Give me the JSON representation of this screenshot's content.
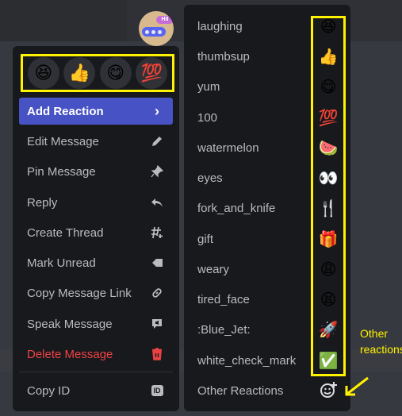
{
  "colors": {
    "accent": "#4752c4",
    "danger": "#ed4245",
    "highlight": "#fff200",
    "menu_bg": "#18191c"
  },
  "avatar": {
    "badge": "HII"
  },
  "quick_reactions": [
    {
      "icon": "laughing",
      "glyph": "😆"
    },
    {
      "icon": "thumbsup",
      "glyph": "👍"
    },
    {
      "icon": "yum",
      "glyph": "😋"
    },
    {
      "icon": "100",
      "glyph": "💯"
    }
  ],
  "menu": {
    "add_reaction": "Add Reaction",
    "add_reaction_chevron": "›",
    "edit": "Edit Message",
    "pin": "Pin Message",
    "reply": "Reply",
    "create_thread": "Create Thread",
    "mark_unread": "Mark Unread",
    "copy_link": "Copy Message Link",
    "speak": "Speak Message",
    "delete": "Delete Message",
    "copy_id": "Copy ID",
    "id_badge": "ID"
  },
  "submenu": {
    "items": [
      {
        "label": "laughing",
        "glyph": "😆"
      },
      {
        "label": "thumbsup",
        "glyph": "👍"
      },
      {
        "label": "yum",
        "glyph": "😋"
      },
      {
        "label": "100",
        "glyph": "💯"
      },
      {
        "label": "watermelon",
        "glyph": "🍉"
      },
      {
        "label": "eyes",
        "glyph": "👀"
      },
      {
        "label": "fork_and_knife",
        "glyph": "🍴"
      },
      {
        "label": "gift",
        "glyph": "🎁"
      },
      {
        "label": "weary",
        "glyph": "😩"
      },
      {
        "label": "tired_face",
        "glyph": "😫"
      },
      {
        "label": ":Blue_Jet:",
        "glyph": "🚀"
      },
      {
        "label": "white_check_mark",
        "glyph": "✅"
      }
    ],
    "other": "Other Reactions",
    "other_icon": "add-emoji-icon"
  },
  "annotation": "Other reactions"
}
